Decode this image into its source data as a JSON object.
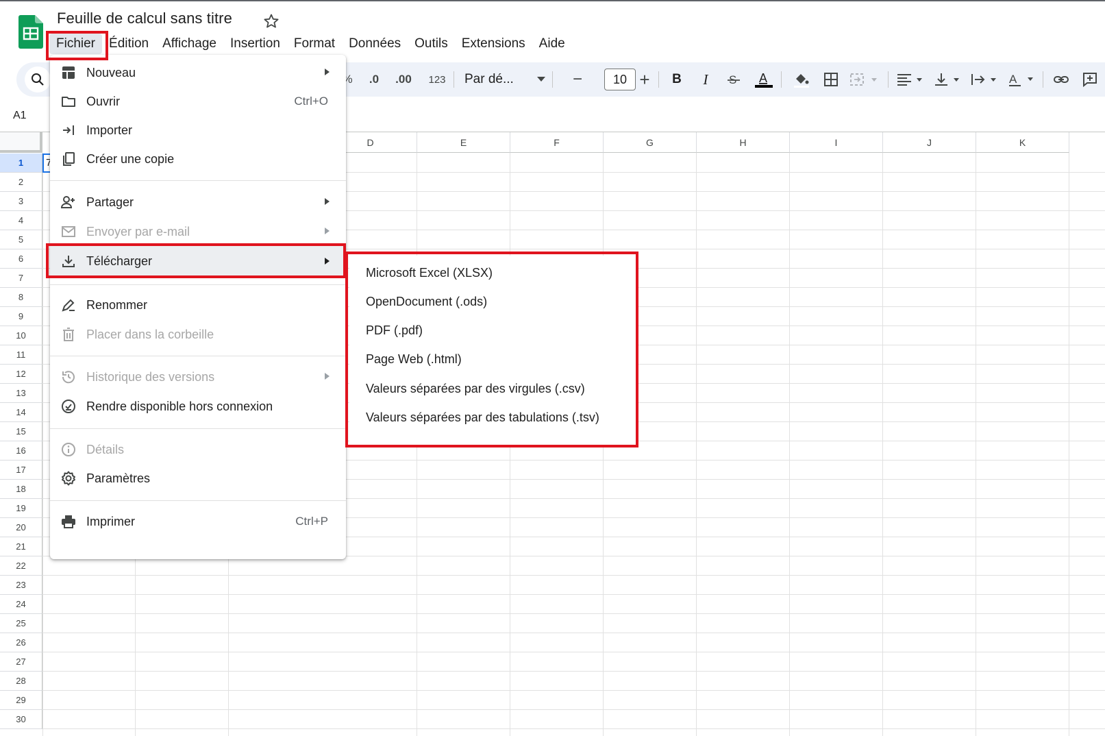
{
  "app": {
    "title": "Feuille de calcul sans titre"
  },
  "menubar": {
    "items": [
      "Fichier",
      "Édition",
      "Affichage",
      "Insertion",
      "Format",
      "Données",
      "Outils",
      "Extensions",
      "Aide"
    ]
  },
  "toolbar": {
    "percent": "%",
    "dec_decrease": ".0",
    "dec_increase": ".00",
    "number_format": "123",
    "font_family": "Par dé...",
    "font_size": "10",
    "minus": "−",
    "plus": "+",
    "bold": "B",
    "italic": "I",
    "text_color_letter": "A",
    "icons": [
      "search-icon",
      "percent-icon",
      "decrease-decimal-icon",
      "increase-decimal-icon",
      "font-dropdown",
      "font-size-decrease-icon",
      "font-size-increase-icon",
      "bold-icon",
      "italic-icon",
      "strikethrough-icon",
      "text-color-icon",
      "fill-color-icon",
      "borders-icon",
      "merge-cells-icon",
      "horizontal-align-icon",
      "vertical-align-icon",
      "text-wrap-icon",
      "text-rotation-icon",
      "link-icon",
      "comment-icon"
    ]
  },
  "namebox": {
    "value": "A1"
  },
  "grid": {
    "columns": [
      "D",
      "E",
      "F",
      "G",
      "H",
      "I",
      "J",
      "K"
    ],
    "rows": [
      "1",
      "2",
      "3",
      "4",
      "5",
      "6",
      "7",
      "8",
      "9",
      "10",
      "11",
      "12",
      "13",
      "14",
      "15",
      "16",
      "17",
      "18",
      "19",
      "20",
      "21",
      "22",
      "23",
      "24",
      "25",
      "26",
      "27",
      "28",
      "29",
      "30"
    ],
    "selected_row": "1",
    "a1_partial": "7"
  },
  "file_menu": {
    "items": [
      {
        "label": "Nouveau",
        "icon": "new-sheet-icon",
        "submenu": true
      },
      {
        "label": "Ouvrir",
        "icon": "folder-icon",
        "shortcut": "Ctrl+O"
      },
      {
        "label": "Importer",
        "icon": "import-icon"
      },
      {
        "label": "Créer une copie",
        "icon": "copy-icon"
      },
      {
        "label": "Partager",
        "icon": "share-person-icon",
        "submenu": true
      },
      {
        "label": "Envoyer par e-mail",
        "icon": "mail-icon",
        "submenu": true,
        "disabled": true
      },
      {
        "label": "Télécharger",
        "icon": "download-icon",
        "submenu": true,
        "highlighted": true
      },
      {
        "label": "Renommer",
        "icon": "rename-icon"
      },
      {
        "label": "Placer dans la corbeille",
        "icon": "trash-icon",
        "disabled": true
      },
      {
        "label": "Historique des versions",
        "icon": "history-icon",
        "submenu": true,
        "disabled": true
      },
      {
        "label": "Rendre disponible hors connexion",
        "icon": "offline-icon"
      },
      {
        "label": "Détails",
        "icon": "info-icon",
        "disabled": true
      },
      {
        "label": "Paramètres",
        "icon": "gear-icon"
      },
      {
        "label": "Imprimer",
        "icon": "printer-icon",
        "shortcut": "Ctrl+P"
      }
    ]
  },
  "download_submenu": {
    "items": [
      "Microsoft Excel (XLSX)",
      "OpenDocument (.ods)",
      "PDF (.pdf)",
      "Page Web (.html)",
      "Valeurs séparées par des virgules (.csv)",
      "Valeurs séparées par des tabulations (.tsv)"
    ]
  },
  "colors": {
    "annotation_red": "#e0141e",
    "sheets_green": "#0f9d58",
    "toolbar_bg": "#eef2f9",
    "selection_blue": "#1a73e8"
  }
}
